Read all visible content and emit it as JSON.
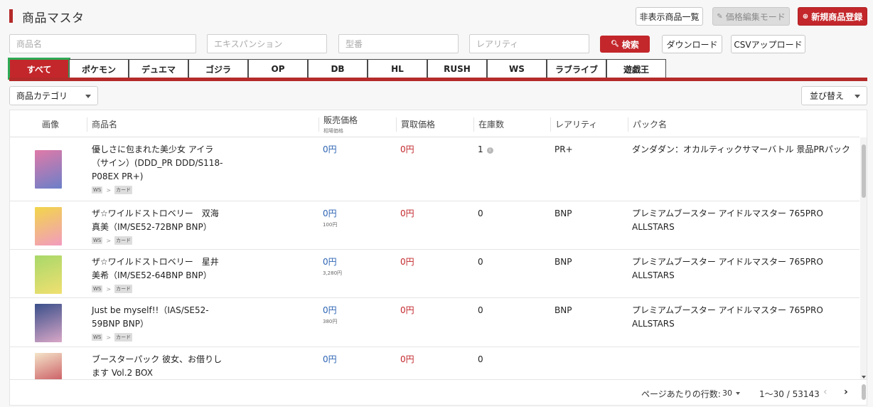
{
  "header": {
    "title": "商品マスタ",
    "hidden_products_label": "非表示商品一覧",
    "price_edit_label": "価格編集モード",
    "new_product_label": "新規商品登録"
  },
  "search": {
    "name_placeholder": "商品名",
    "expansion_placeholder": "エキスパンション",
    "number_placeholder": "型番",
    "rarity_placeholder": "レアリティ",
    "search_label": "検索",
    "download_label": "ダウンロード",
    "csv_upload_label": "CSVアップロード"
  },
  "tabs": [
    {
      "label": "すべて",
      "active": true
    },
    {
      "label": "ポケモン"
    },
    {
      "label": "デュエマ"
    },
    {
      "label": "ゴジラ"
    },
    {
      "label": "OP"
    },
    {
      "label": "DB"
    },
    {
      "label": "HL"
    },
    {
      "label": "RUSH"
    },
    {
      "label": "WS"
    },
    {
      "label": "ラブライブ"
    },
    {
      "label": "遊戯王"
    }
  ],
  "filters": {
    "category_label": "商品カテゴリ",
    "sort_label": "並び替え"
  },
  "table": {
    "columns": {
      "image": "画像",
      "name": "商品名",
      "sale_price": "販売価格",
      "sale_price_sub": "相場価格",
      "buy_price": "買取価格",
      "stock": "在庫数",
      "rarity": "レアリティ",
      "pack": "パック名"
    },
    "rows": [
      {
        "name": "優しさに包まれた美少女 アイラ（サイン）(DDD_PR DDD/S118-P08EX PR+)",
        "name_lines": [
          "優しさに包まれた美少女 アイラ",
          "（サイン）(DDD_PR DDD/S118-",
          "P08EX PR+)"
        ],
        "crumb_game": "WS",
        "crumb_type": "カード",
        "sale": "0円",
        "sale_sub": "",
        "buy": "0円",
        "stock": "1",
        "stock_info": true,
        "rarity": "PR+",
        "pack": "ダンダダン：オカルティックサマーバトル 景品PRパック",
        "thumb_colors": [
          "#e07aa8",
          "#6b7fc9"
        ]
      },
      {
        "name": "ザ☆ワイルドストロベリー　双海真美（IM/SE52-72BNP BNP）",
        "name_lines": [
          "ザ☆ワイルドストロベリー　双海",
          "真美（IM/SE52-72BNP BNP）"
        ],
        "crumb_game": "WS",
        "crumb_type": "カード",
        "sale": "0円",
        "sale_sub": "100円",
        "buy": "0円",
        "stock": "0",
        "stock_info": false,
        "rarity": "BNP",
        "pack": "プレミアムブースター アイドルマスター 765PRO ALLSTARS",
        "thumb_colors": [
          "#f2d64a",
          "#f29bbf"
        ]
      },
      {
        "name": "ザ☆ワイルドストロベリー　星井美希（IM/SE52-64BNP BNP）",
        "name_lines": [
          "ザ☆ワイルドストロベリー　星井",
          "美希（IM/SE52-64BNP BNP）"
        ],
        "crumb_game": "WS",
        "crumb_type": "カード",
        "sale": "0円",
        "sale_sub": "3,280円",
        "buy": "0円",
        "stock": "0",
        "stock_info": false,
        "rarity": "BNP",
        "pack": "プレミアムブースター アイドルマスター 765PRO ALLSTARS",
        "thumb_colors": [
          "#a8d86a",
          "#f0e070"
        ]
      },
      {
        "name": "Just be myself!!（IAS/SE52-59BNP BNP）",
        "name_lines": [
          "Just be myself!!（IAS/SE52-",
          "59BNP BNP）"
        ],
        "crumb_game": "WS",
        "crumb_type": "カード",
        "sale": "0円",
        "sale_sub": "380円",
        "buy": "0円",
        "stock": "0",
        "stock_info": false,
        "rarity": "BNP",
        "pack": "プレミアムブースター アイドルマスター 765PRO ALLSTARS",
        "thumb_colors": [
          "#3a4f8a",
          "#d9a7c7"
        ]
      },
      {
        "name": "ブースターパック 彼女、お借りします Vol.2 BOX",
        "name_lines": [
          "ブースターパック 彼女、お借りし",
          "ます Vol.2 BOX"
        ],
        "crumb_game": "",
        "crumb_type": "",
        "sale": "0円",
        "sale_sub": "",
        "buy": "0円",
        "stock": "0",
        "stock_info": false,
        "rarity": "",
        "pack": "",
        "thumb_colors": [
          "#f4e4c8",
          "#c0384a"
        ]
      }
    ]
  },
  "pagination": {
    "rows_per_page_label": "ページあたりの行数:",
    "rows_per_page_value": "30",
    "range_label": "1〜30 / 53143"
  }
}
